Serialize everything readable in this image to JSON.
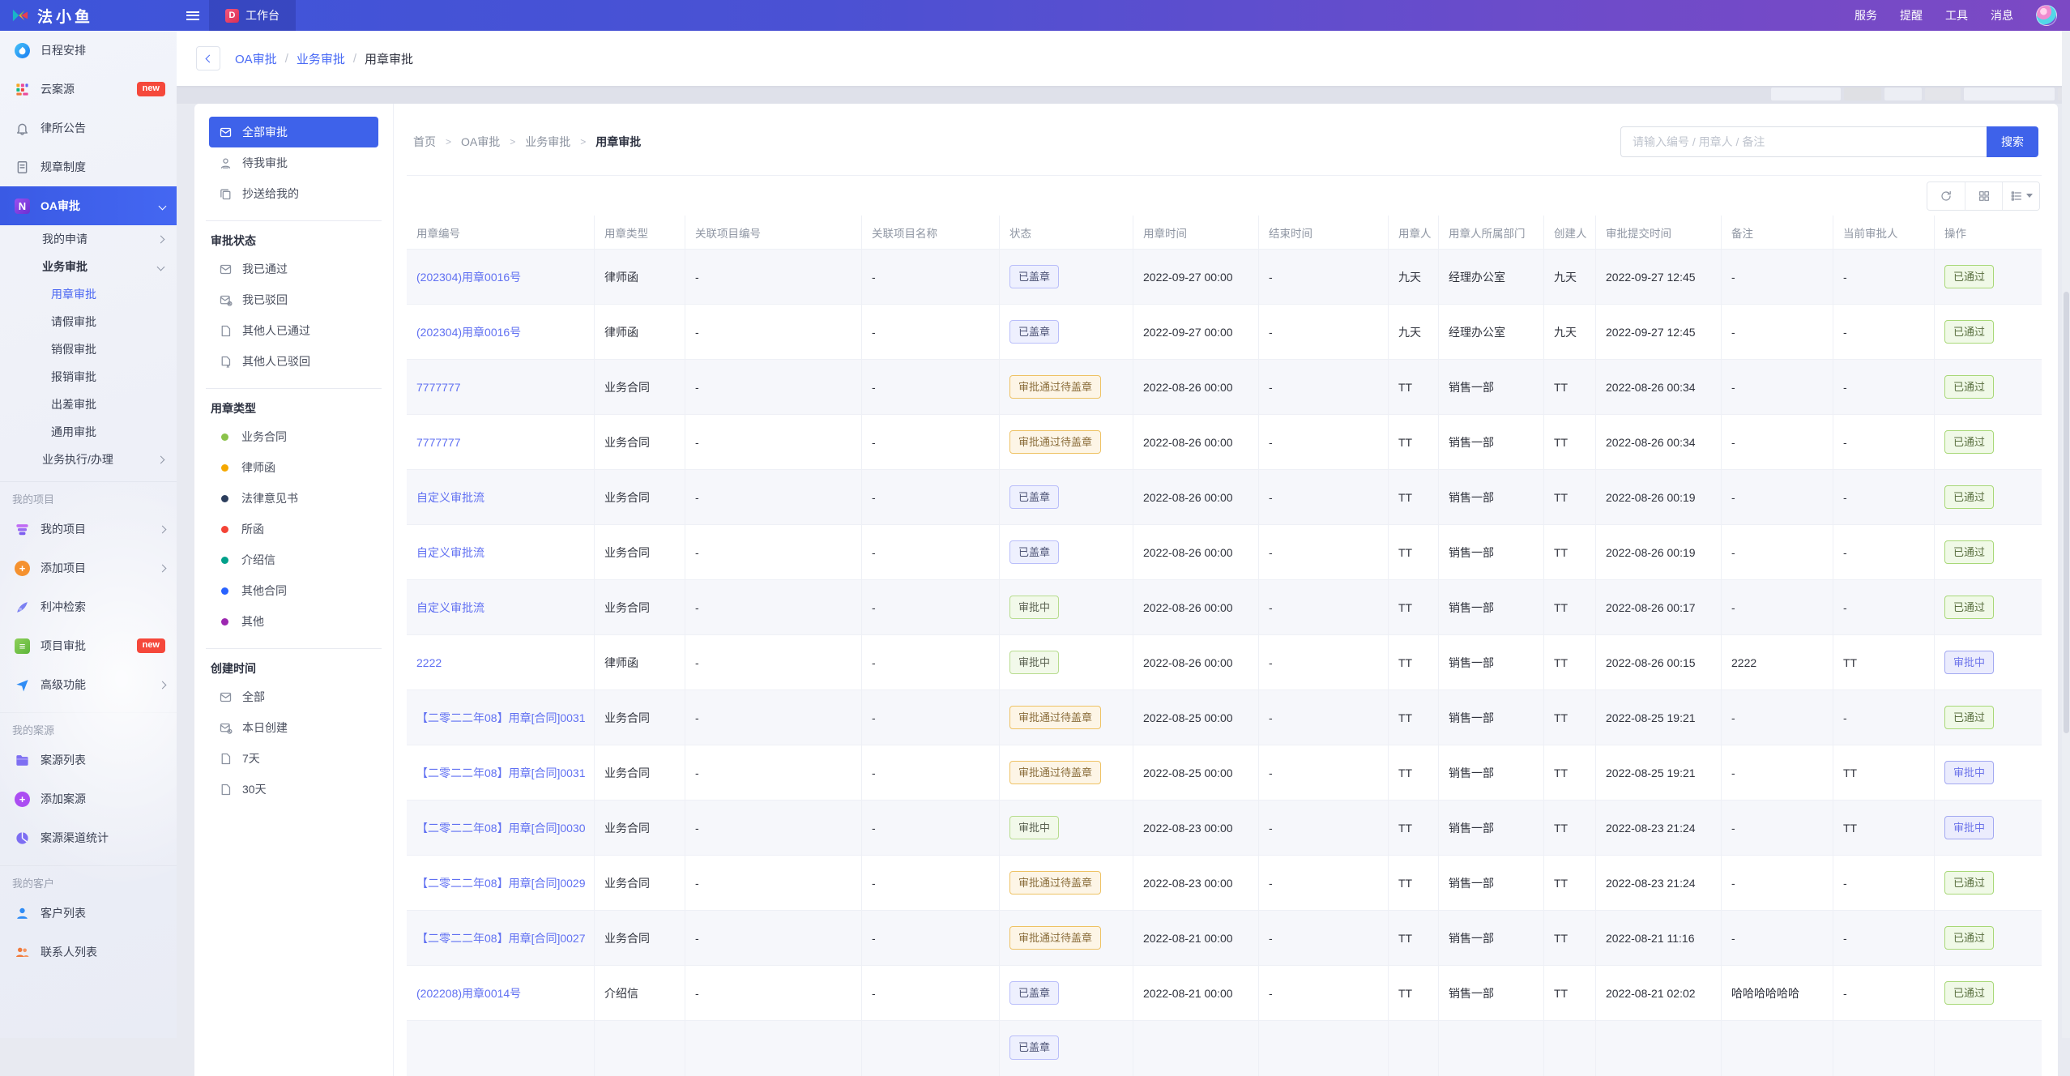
{
  "topbar": {
    "logo_text": "法小鱼",
    "workbench_tab": "工作台",
    "workbench_icon_letter": "D",
    "menu": [
      "服务",
      "提醒",
      "工具",
      "消息"
    ]
  },
  "page_header": {
    "breadcrumb": [
      "OA审批",
      "业务审批",
      "用章审批"
    ]
  },
  "sidebar": {
    "groups": [
      {
        "label": "",
        "items": [
          {
            "label": "日程安排",
            "icon": "schedule"
          },
          {
            "label": "云案源",
            "icon": "casebank",
            "badge": "new"
          },
          {
            "label": "律所公告",
            "icon": "bell"
          },
          {
            "label": "规章制度",
            "icon": "rules"
          },
          {
            "label": "OA审批",
            "icon": "oa",
            "active": true,
            "chevron": "down",
            "children": [
              {
                "label": "我的申请",
                "chevron": "right"
              },
              {
                "label": "业务审批",
                "bold": true,
                "chevron": "down",
                "children": [
                  {
                    "label": "用章审批",
                    "active": true
                  },
                  {
                    "label": "请假审批"
                  },
                  {
                    "label": "销假审批"
                  },
                  {
                    "label": "报销审批"
                  },
                  {
                    "label": "出差审批"
                  },
                  {
                    "label": "通用审批"
                  }
                ]
              },
              {
                "label": "业务执行/办理",
                "chevron": "right"
              }
            ]
          }
        ]
      },
      {
        "label": "我的项目",
        "items": [
          {
            "label": "我的项目",
            "icon": "projects",
            "chevron": "right"
          },
          {
            "label": "添加项目",
            "icon": "add-project",
            "chevron": "right"
          },
          {
            "label": "利冲检索",
            "icon": "conflict"
          },
          {
            "label": "项目审批",
            "icon": "project-approval",
            "badge": "new"
          },
          {
            "label": "高级功能",
            "icon": "advanced",
            "chevron": "right"
          }
        ]
      },
      {
        "label": "我的案源",
        "items": [
          {
            "label": "案源列表",
            "icon": "case-list"
          },
          {
            "label": "添加案源",
            "icon": "add-case"
          },
          {
            "label": "案源渠道统计",
            "icon": "case-stats"
          }
        ]
      },
      {
        "label": "我的客户",
        "items": [
          {
            "label": "客户列表",
            "icon": "customers"
          },
          {
            "label": "联系人列表",
            "icon": "contacts"
          }
        ]
      }
    ]
  },
  "filter_panel": {
    "quick": [
      {
        "label": "全部审批",
        "icon": "mail",
        "active": true
      },
      {
        "label": "待我审批",
        "icon": "person"
      },
      {
        "label": "抄送给我的",
        "icon": "copy"
      }
    ],
    "sections": [
      {
        "title": "审批状态",
        "items": [
          {
            "label": "我已通过",
            "icon": "mail"
          },
          {
            "label": "我已驳回",
            "icon": "mail-x"
          },
          {
            "label": "其他人已通过",
            "icon": "file"
          },
          {
            "label": "其他人已驳回",
            "icon": "file-x"
          }
        ]
      },
      {
        "title": "用章类型",
        "items": [
          {
            "label": "业务合同",
            "dot": "#8bc34a"
          },
          {
            "label": "律师函",
            "dot": "#f5a800"
          },
          {
            "label": "法律意见书",
            "dot": "#2c3e5d"
          },
          {
            "label": "所函",
            "dot": "#f44336"
          },
          {
            "label": "介绍信",
            "dot": "#00a08a"
          },
          {
            "label": "其他合同",
            "dot": "#2962ff"
          },
          {
            "label": "其他",
            "dot": "#9c27b0"
          }
        ]
      },
      {
        "title": "创建时间",
        "items": [
          {
            "label": "全部",
            "icon": "mail"
          },
          {
            "label": "本日创建",
            "icon": "mail-clock"
          },
          {
            "label": "7天",
            "icon": "file"
          },
          {
            "label": "30天",
            "icon": "file"
          }
        ]
      }
    ]
  },
  "main": {
    "breadcrumb": [
      "首页",
      "OA审批",
      "业务审批",
      "用章审批"
    ],
    "search": {
      "placeholder": "请输入编号 / 用章人 / 备注",
      "button": "搜索"
    },
    "toolbar_icons": [
      "refresh",
      "grid",
      "columns"
    ],
    "table": {
      "columns": [
        "用章编号",
        "用章类型",
        "关联项目编号",
        "关联项目名称",
        "状态",
        "用章时间",
        "结束时间",
        "用章人",
        "用章人所属部门",
        "创建人",
        "审批提交时间",
        "备注",
        "当前审批人",
        "操作"
      ],
      "status_palette": {
        "stamped": "#b9befa",
        "wait": "#eec264",
        "green": "#b7dc8e",
        "passed": "#a8d878",
        "approving": "#a3a9f1"
      },
      "rows": [
        {
          "no": "(202304)用章0016号",
          "type": "律师函",
          "proj_no": "-",
          "proj_name": "-",
          "status": "已盖章",
          "sv": "stamped",
          "use": "2022-09-27 00:00",
          "end": "-",
          "user": "九天",
          "dept": "经理办公室",
          "creator": "九天",
          "submit": "2022-09-27 12:45",
          "remark": "-",
          "approver": "-",
          "action": "已通过",
          "av": "passed"
        },
        {
          "no": "(202304)用章0016号",
          "type": "律师函",
          "proj_no": "-",
          "proj_name": "-",
          "status": "已盖章",
          "sv": "stamped",
          "use": "2022-09-27 00:00",
          "end": "-",
          "user": "九天",
          "dept": "经理办公室",
          "creator": "九天",
          "submit": "2022-09-27 12:45",
          "remark": "-",
          "approver": "-",
          "action": "已通过",
          "av": "passed"
        },
        {
          "no": "7777777",
          "type": "业务合同",
          "proj_no": "-",
          "proj_name": "-",
          "status": "审批通过待盖章",
          "sv": "wait",
          "use": "2022-08-26 00:00",
          "end": "-",
          "user": "TT",
          "dept": "销售一部",
          "creator": "TT",
          "submit": "2022-08-26 00:34",
          "remark": "-",
          "approver": "-",
          "action": "已通过",
          "av": "passed"
        },
        {
          "no": "7777777",
          "type": "业务合同",
          "proj_no": "-",
          "proj_name": "-",
          "status": "审批通过待盖章",
          "sv": "wait",
          "use": "2022-08-26 00:00",
          "end": "-",
          "user": "TT",
          "dept": "销售一部",
          "creator": "TT",
          "submit": "2022-08-26 00:34",
          "remark": "-",
          "approver": "-",
          "action": "已通过",
          "av": "passed"
        },
        {
          "no": "自定义审批流",
          "type": "业务合同",
          "proj_no": "-",
          "proj_name": "-",
          "status": "已盖章",
          "sv": "stamped",
          "use": "2022-08-26 00:00",
          "end": "-",
          "user": "TT",
          "dept": "销售一部",
          "creator": "TT",
          "submit": "2022-08-26 00:19",
          "remark": "-",
          "approver": "-",
          "action": "已通过",
          "av": "passed"
        },
        {
          "no": "自定义审批流",
          "type": "业务合同",
          "proj_no": "-",
          "proj_name": "-",
          "status": "已盖章",
          "sv": "stamped",
          "use": "2022-08-26 00:00",
          "end": "-",
          "user": "TT",
          "dept": "销售一部",
          "creator": "TT",
          "submit": "2022-08-26 00:19",
          "remark": "-",
          "approver": "-",
          "action": "已通过",
          "av": "passed"
        },
        {
          "no": "自定义审批流",
          "type": "业务合同",
          "proj_no": "-",
          "proj_name": "-",
          "status": "审批中",
          "sv": "green",
          "use": "2022-08-26 00:00",
          "end": "-",
          "user": "TT",
          "dept": "销售一部",
          "creator": "TT",
          "submit": "2022-08-26 00:17",
          "remark": "-",
          "approver": "-",
          "action": "已通过",
          "av": "passed"
        },
        {
          "no": "2222",
          "type": "律师函",
          "proj_no": "-",
          "proj_name": "-",
          "status": "审批中",
          "sv": "green",
          "use": "2022-08-26 00:00",
          "end": "-",
          "user": "TT",
          "dept": "销售一部",
          "creator": "TT",
          "submit": "2022-08-26 00:15",
          "remark": "2222",
          "approver": "TT",
          "action": "审批中",
          "av": "approving"
        },
        {
          "no": "【二零二二年08】用章[合同]0031",
          "type": "业务合同",
          "proj_no": "-",
          "proj_name": "-",
          "status": "审批通过待盖章",
          "sv": "wait",
          "use": "2022-08-25 00:00",
          "end": "-",
          "user": "TT",
          "dept": "销售一部",
          "creator": "TT",
          "submit": "2022-08-25 19:21",
          "remark": "-",
          "approver": "-",
          "action": "已通过",
          "av": "passed"
        },
        {
          "no": "【二零二二年08】用章[合同]0031",
          "type": "业务合同",
          "proj_no": "-",
          "proj_name": "-",
          "status": "审批通过待盖章",
          "sv": "wait",
          "use": "2022-08-25 00:00",
          "end": "-",
          "user": "TT",
          "dept": "销售一部",
          "creator": "TT",
          "submit": "2022-08-25 19:21",
          "remark": "-",
          "approver": "TT",
          "action": "审批中",
          "av": "approving"
        },
        {
          "no": "【二零二二年08】用章[合同]0030",
          "type": "业务合同",
          "proj_no": "-",
          "proj_name": "-",
          "status": "审批中",
          "sv": "green",
          "use": "2022-08-23 00:00",
          "end": "-",
          "user": "TT",
          "dept": "销售一部",
          "creator": "TT",
          "submit": "2022-08-23 21:24",
          "remark": "-",
          "approver": "TT",
          "action": "审批中",
          "av": "approving"
        },
        {
          "no": "【二零二二年08】用章[合同]0029",
          "type": "业务合同",
          "proj_no": "-",
          "proj_name": "-",
          "status": "审批通过待盖章",
          "sv": "wait",
          "use": "2022-08-23 00:00",
          "end": "-",
          "user": "TT",
          "dept": "销售一部",
          "creator": "TT",
          "submit": "2022-08-23 21:24",
          "remark": "-",
          "approver": "-",
          "action": "已通过",
          "av": "passed"
        },
        {
          "no": "【二零二二年08】用章[合同]0027",
          "type": "业务合同",
          "proj_no": "-",
          "proj_name": "-",
          "status": "审批通过待盖章",
          "sv": "wait",
          "use": "2022-08-21 00:00",
          "end": "-",
          "user": "TT",
          "dept": "销售一部",
          "creator": "TT",
          "submit": "2022-08-21 11:16",
          "remark": "-",
          "approver": "-",
          "action": "已通过",
          "av": "passed"
        },
        {
          "no": "(202208)用章0014号",
          "type": "介绍信",
          "proj_no": "-",
          "proj_name": "-",
          "status": "已盖章",
          "sv": "stamped",
          "use": "2022-08-21 00:00",
          "end": "-",
          "user": "TT",
          "dept": "销售一部",
          "creator": "TT",
          "submit": "2022-08-21 02:02",
          "remark": "哈哈哈哈哈哈",
          "approver": "-",
          "action": "已通过",
          "av": "passed"
        },
        {
          "no": "",
          "type": "",
          "proj_no": "",
          "proj_name": "",
          "status": "已盖章",
          "sv": "stamped",
          "use": "",
          "end": "",
          "user": "",
          "dept": "",
          "creator": "",
          "submit": "",
          "remark": "",
          "approver": "",
          "action": "",
          "av": "",
          "partial": true
        }
      ]
    }
  },
  "colors": {
    "accent": "#3e62ea",
    "topbar_gradient_left": "#3d55da",
    "topbar_gradient_right": "#7c49c4",
    "link": "#6070f2",
    "new_badge": "#f5483b"
  }
}
